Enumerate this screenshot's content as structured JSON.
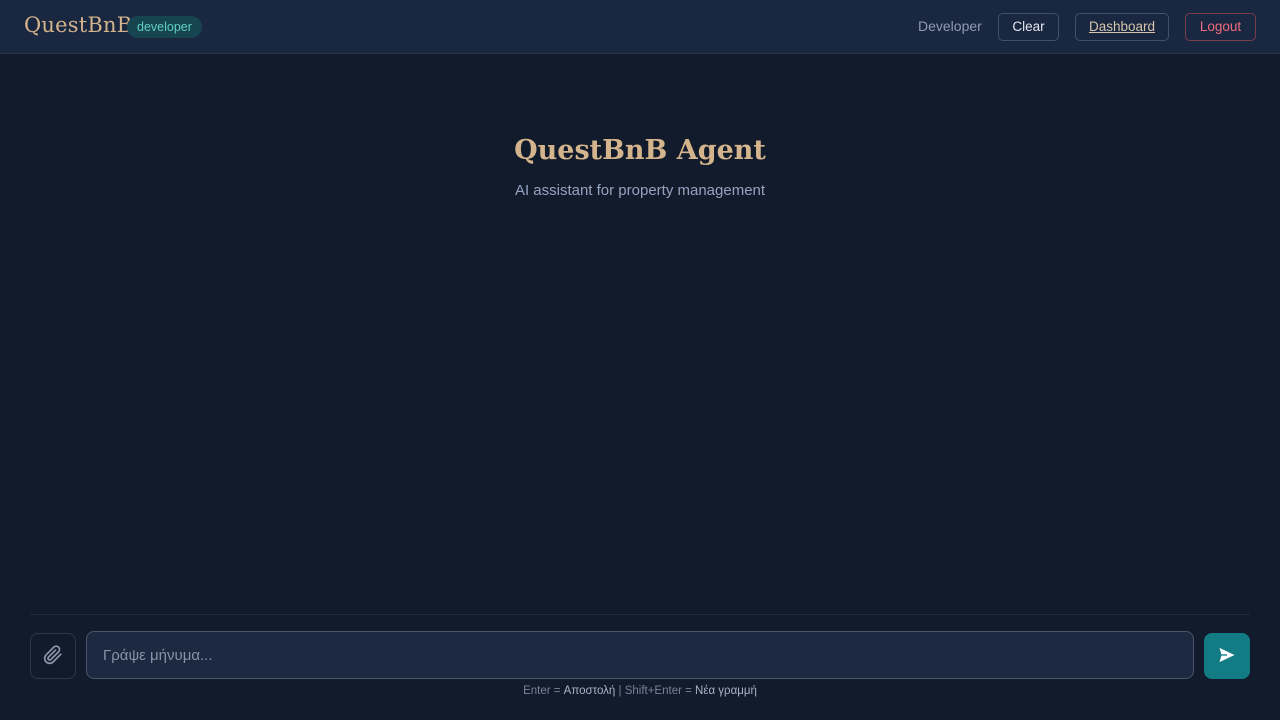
{
  "header": {
    "logo": "QuestBnB",
    "role_badge": "developer",
    "user_name": "Developer",
    "buttons": {
      "clear": "Clear",
      "dashboard": "Dashboard",
      "logout": "Logout"
    }
  },
  "hero": {
    "title": "QuestBnB Agent",
    "subtitle": "AI assistant for property management"
  },
  "composer": {
    "attach_icon": "paperclip-icon",
    "placeholder": "Γράψε μήνυμα...",
    "send_icon": "send-icon",
    "hint": {
      "enter_key": "Enter = ",
      "enter_action": "Αποστολή",
      "separator": " | ",
      "shift_key": "Shift+Enter = ",
      "shift_action": "Νέα γραμμή"
    }
  },
  "colors": {
    "background": "#111b2b",
    "header": "#1a2740",
    "accent_gold": "#d4b48c",
    "accent_teal": "#127b84",
    "logout_red": "#f06c7e"
  }
}
